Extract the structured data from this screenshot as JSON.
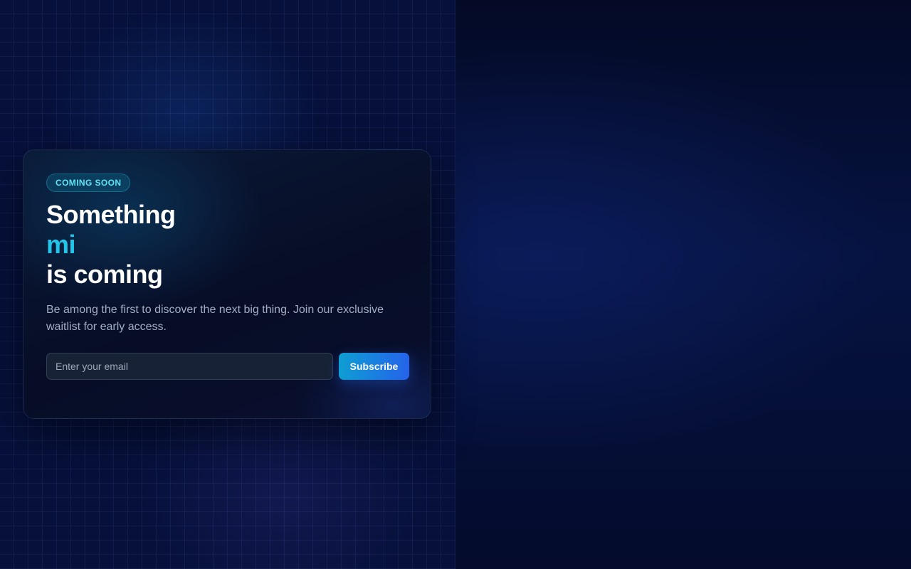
{
  "badge": {
    "label": "COMING SOON"
  },
  "headline": {
    "line1": "Something",
    "accent": "mi",
    "line3": "is coming"
  },
  "description": "Be among the first to discover the next big thing. Join our exclusive waitlist for early access.",
  "form": {
    "email_placeholder": "Enter your email",
    "email_value": "",
    "subscribe_label": "Subscribe"
  },
  "colors": {
    "accent": "#22c4e8",
    "badge_text": "#5fe3f5",
    "button_start": "#0e9ed3",
    "button_end": "#2563eb",
    "background": "#050b26"
  }
}
